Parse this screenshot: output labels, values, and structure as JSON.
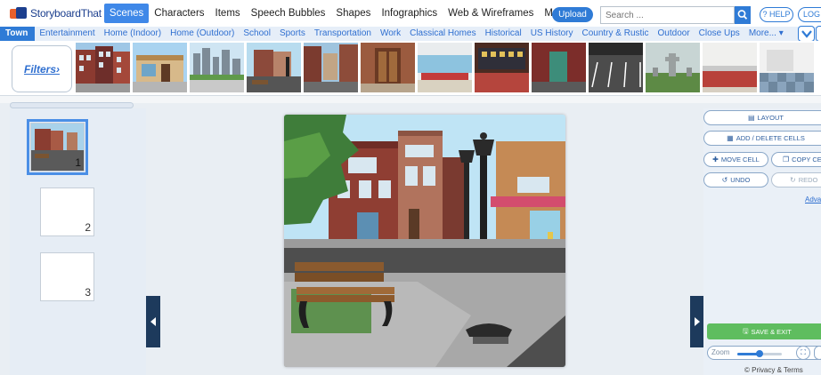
{
  "app": {
    "logo_text": "StoryboardThat"
  },
  "topmenu": {
    "items": [
      "Scenes",
      "Characters",
      "Items",
      "Speech Bubbles",
      "Shapes",
      "Infographics",
      "Web & Wireframes",
      "More... ▾"
    ],
    "active_index": 0,
    "upload_label": "Upload",
    "search_placeholder": "Search ...",
    "help_label": "? HELP",
    "login_label": "LOG"
  },
  "categories": {
    "items": [
      "Town",
      "Entertainment",
      "Home (Indoor)",
      "Home (Outdoor)",
      "School",
      "Sports",
      "Transportation",
      "Work",
      "Classical Homes",
      "Historical",
      "US History",
      "Country & Rustic",
      "Outdoor",
      "Close Ups",
      "More... ▾"
    ],
    "active_index": 0
  },
  "strip": {
    "filters_label": "Filters›",
    "thumbnails": [
      "brick-rowhouses",
      "storefront",
      "city-skyline-park",
      "street-corner",
      "downtown-street",
      "building-entrance",
      "diner-interior",
      "shop-counter",
      "alley-door",
      "parking-lot",
      "cemetery",
      "kitchen-counter",
      "tiled-room"
    ]
  },
  "cells": [
    {
      "number": "1",
      "selected": true
    },
    {
      "number": "2",
      "selected": false
    },
    {
      "number": "3",
      "selected": false
    }
  ],
  "panel": {
    "layout_label": "LAYOUT",
    "add_delete_label": "ADD / DELETE CELLS",
    "move_cell_label": "MOVE CELL",
    "copy_cell_label": "COPY CEL",
    "undo_label": "UNDO",
    "redo_label": "REDO",
    "advanced_label": "Adva",
    "save_exit_label": "SAVE & EXIT",
    "zoom_label": "Zoom",
    "zoom_level": 0.5,
    "privacy_label": "© Privacy & Terms"
  },
  "colors": {
    "accent": "#2f7bd6",
    "dark_toggle": "#1d3a5c",
    "save_green": "#5fbd5f"
  }
}
